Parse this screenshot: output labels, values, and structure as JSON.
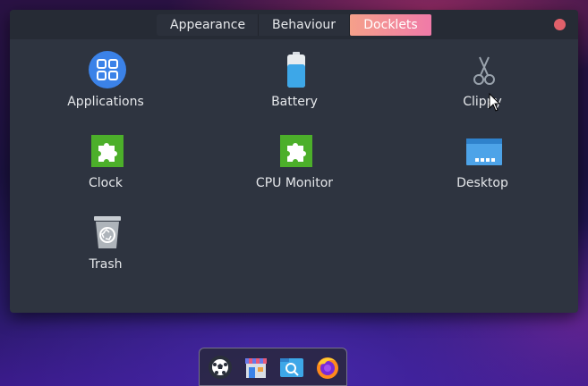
{
  "tabs": [
    {
      "label": "Appearance",
      "active": false
    },
    {
      "label": "Behaviour",
      "active": false
    },
    {
      "label": "Docklets",
      "active": true
    }
  ],
  "docklets": [
    {
      "label": "Applications",
      "icon": "apps-grid-icon"
    },
    {
      "label": "Battery",
      "icon": "battery-icon"
    },
    {
      "label": "Clippy",
      "icon": "scissors-icon"
    },
    {
      "label": "Clock",
      "icon": "puzzle-icon"
    },
    {
      "label": "CPU Monitor",
      "icon": "puzzle-icon"
    },
    {
      "label": "Desktop",
      "icon": "desktop-folder-icon"
    },
    {
      "label": "Trash",
      "icon": "trash-icon"
    }
  ],
  "dock": {
    "items": [
      "soccer-ball-icon",
      "store-icon",
      "file-search-icon",
      "firefox-icon"
    ]
  },
  "colors": {
    "active_tab_gradient_start": "#f5a08a",
    "active_tab_gradient_end": "#f07aa8",
    "window_bg": "#2e3440",
    "close_button": "#e0606a"
  }
}
